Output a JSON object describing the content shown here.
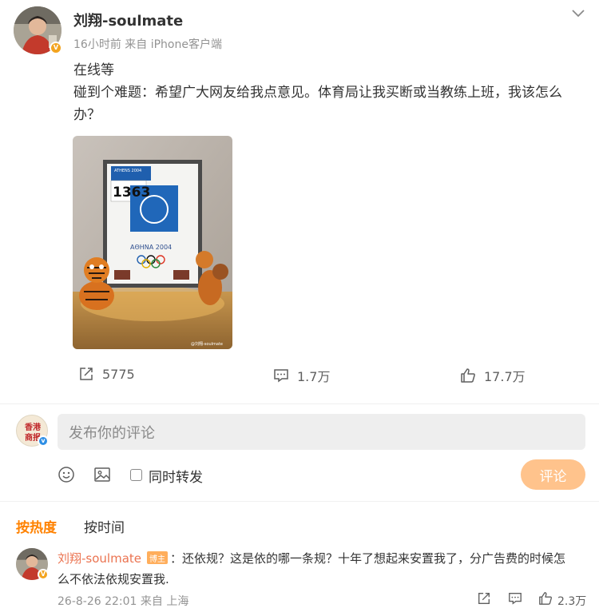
{
  "post": {
    "author": "刘翔-soulmate",
    "meta": "16小时前 来自 iPhone客户端",
    "line1": "在线等",
    "line2": "碰到个难题：希望广大网友给我点意见。体育局让我买断或当教练上班，我该怎么",
    "line3": "办？",
    "image": {
      "top_banner": "ATHENS 2004",
      "bib": "1363",
      "caption": "ΑΘΗΝΑ 2004",
      "watermark": "@刘翔-soulmate"
    },
    "actions": {
      "repost": "5775",
      "comment": "1.7万",
      "like": "17.7万"
    }
  },
  "composer": {
    "avatar_text_1": "香港",
    "avatar_text_2": "商报",
    "placeholder": "发布你的评论",
    "repost_label": "同时转发",
    "submit": "评论"
  },
  "sort": {
    "hot": "按热度",
    "time": "按时间"
  },
  "comment": {
    "author": "刘翔-soulmate",
    "tag": "博主",
    "text1": "：还依规？这是依的哪一条规？十年了想起来安置我了，分广告费的时候怎",
    "text2": "么不依法依规安置我.",
    "meta": "26-8-26 22:01 来自 上海",
    "like": "2.3万"
  },
  "colors": {
    "accent": "#ff8200",
    "name_link": "#eb7350",
    "submit_disabled": "#ffc38c",
    "verified_gold": "#f3a41f",
    "verified_blue": "#2f8fe5"
  }
}
